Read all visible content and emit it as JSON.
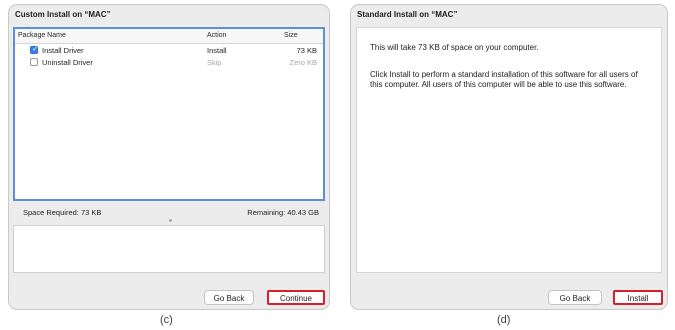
{
  "custom_install": {
    "title": "Custom Install on “MAC”",
    "columns": {
      "name": "Package Name",
      "action": "Action",
      "size": "Size"
    },
    "packages": [
      {
        "name": "Install Driver",
        "checked": true,
        "action": "Install",
        "size": "73 KB"
      },
      {
        "name": "Uninstall Driver",
        "checked": false,
        "action": "Skip",
        "size": "Zero KB"
      }
    ],
    "space_required": "Space Required:  73 KB",
    "remaining": "Remaining:  40.43 GB",
    "buttons": {
      "go_back": "Go Back",
      "continue": "Continue"
    }
  },
  "standard_install": {
    "title": "Standard Install on “MAC”",
    "message_1": "This will take 73 KB of space on your computer.",
    "message_2": "Click Install to perform a standard installation of this software for all users of this computer. All users of this computer will be able to use this software.",
    "buttons": {
      "go_back": "Go Back",
      "install": "Install"
    }
  },
  "captions": {
    "c": "(c)",
    "d": "(d)"
  },
  "colors": {
    "selection_border": "#5b8fd6",
    "highlight_border": "#d71f2b",
    "checkbox": "#3d7ee5"
  },
  "icons": {
    "checkbox_checked": "check-mark"
  }
}
